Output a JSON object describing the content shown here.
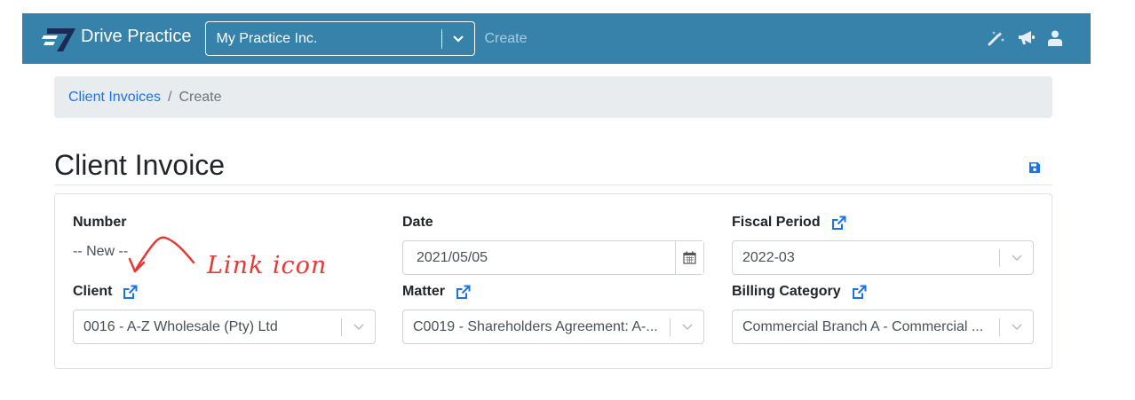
{
  "navbar": {
    "brand": "Drive Practice",
    "practice_selected": "My Practice Inc.",
    "create_label": "Create",
    "icons": [
      "magic-wand-icon",
      "megaphone-icon",
      "user-icon"
    ]
  },
  "breadcrumb": {
    "parent": "Client Invoices",
    "separator": "/",
    "current": "Create"
  },
  "page": {
    "title": "Client Invoice"
  },
  "form": {
    "number": {
      "label": "Number",
      "value": "-- New --"
    },
    "date": {
      "label": "Date",
      "value": "2021/05/05"
    },
    "fiscal_period": {
      "label": "Fiscal Period",
      "value": "2022-03"
    },
    "client": {
      "label": "Client",
      "value": "0016 - A-Z Wholesale (Pty) Ltd"
    },
    "matter": {
      "label": "Matter",
      "value": "C0019 - Shareholders Agreement: A-..."
    },
    "billing_category": {
      "label": "Billing Category",
      "value": "Commercial Branch A - Commercial ..."
    }
  },
  "annotation": {
    "text": "Link icon"
  },
  "colors": {
    "navbar": "#3682aa",
    "link": "#1a73e8",
    "annotation": "#e53935"
  }
}
